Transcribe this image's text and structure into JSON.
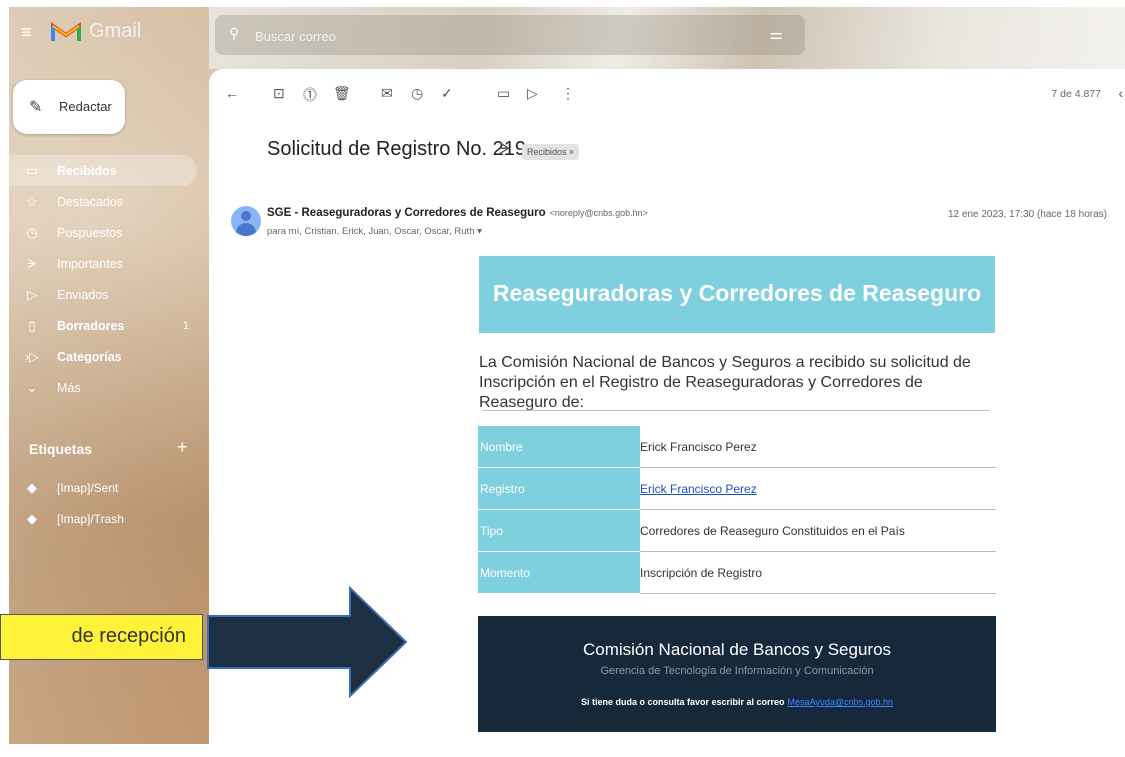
{
  "header": {
    "app_name": "Gmail",
    "search_placeholder": "Buscar correo"
  },
  "sidebar": {
    "compose_label": "Redactar",
    "items": [
      {
        "label": "Recibidos",
        "icon": "inbox-icon",
        "active": true,
        "bold": true,
        "count": ""
      },
      {
        "label": "Destacados",
        "icon": "star-icon",
        "active": false,
        "bold": false,
        "count": ""
      },
      {
        "label": "Pospuestos",
        "icon": "clock-icon",
        "active": false,
        "bold": false,
        "count": ""
      },
      {
        "label": "Importantes",
        "icon": "important-icon",
        "active": false,
        "bold": false,
        "count": ""
      },
      {
        "label": "Enviados",
        "icon": "send-icon",
        "active": false,
        "bold": false,
        "count": ""
      },
      {
        "label": "Borradores",
        "icon": "draft-icon",
        "active": false,
        "bold": true,
        "count": "1"
      },
      {
        "label": "Categorías",
        "icon": "label-icon",
        "active": false,
        "bold": true,
        "count": ""
      },
      {
        "label": "Más",
        "icon": "chevron-down-icon",
        "active": false,
        "bold": false,
        "count": ""
      }
    ],
    "labels_heading": "Etiquetas",
    "labels": [
      "[Imap]/Sent",
      "[Imap]/Trash"
    ]
  },
  "toolbar": {
    "pager": "7 de 4.877"
  },
  "message": {
    "subject": "Solicitud de Registro No. 219",
    "inbox_chip": "Recibidos ×",
    "sender_name": "SGE - Reaseguradoras y Corredores de Reaseguro",
    "sender_email": "<noreply@cnbs.gob.hn>",
    "recipients": "para mí, Cristian, Erick, Juan, Oscar, Oscar, Ruth ▾",
    "date": "12 ene 2023, 17:30 (hace 18 horas)"
  },
  "email_body": {
    "banner_title": "Reaseguradoras y Corredores de Reaseguro",
    "intro": "La Comisión Nacional de Bancos y Seguros a recibido su solicitud de Inscripción en el Registro de Reaseguradoras y Corredores de Reaseguro de:",
    "rows": [
      {
        "key": "Nombre",
        "value": "Erick Francisco Perez",
        "link": false
      },
      {
        "key": "Registro",
        "value": "Erick Francisco Perez",
        "link": true
      },
      {
        "key": "Tipo",
        "value": "Corredores de Reaseguro Constituidos en el País",
        "link": false
      },
      {
        "key": "Momento",
        "value": "Inscripción de Registro",
        "link": false
      }
    ],
    "footer_org": "Comisión Nacional de Bancos y Seguros",
    "footer_dept": "Gerencia de Tecnología de Información y Comunicación",
    "footer_contact": "Si tiene duda o consulta favor escribir al correo",
    "footer_email": "MesaAyuda@cnbs.gob.hn"
  },
  "annotation": {
    "callout_text": "de recepción",
    "callout_color": "#fff33a",
    "arrow_color": "#1c2f43"
  }
}
